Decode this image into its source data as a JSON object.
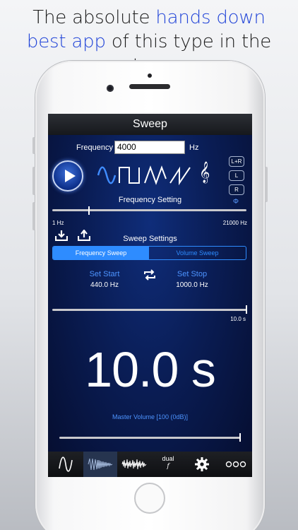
{
  "headline": {
    "part1": "The absolute ",
    "highlight1": "hands down",
    "highlight2": "best app",
    "part2": " of this type in the store."
  },
  "colors": {
    "headline_highlight": "#2245d8",
    "accent_blue": "#2e8cff",
    "screen_bg": "#0a1d55"
  },
  "screen": {
    "title": "Sweep",
    "frequency_label": "Frequency",
    "frequency_value": "4000",
    "frequency_unit": "Hz",
    "play_icon": "play-icon",
    "waveforms": [
      "sine-wave-icon",
      "square-wave-icon",
      "triangle-wave-icon",
      "sawtooth-wave-icon"
    ],
    "treble_clef_icon": "treble-clef-icon",
    "channels": [
      "L+R",
      "L",
      "R"
    ],
    "phase_symbol": "Φ",
    "frequency_setting_label": "Frequency Setting",
    "freq_slider_min": "1 Hz",
    "freq_slider_max": "21000 Hz",
    "freq_slider_fraction": 0.19,
    "download_icon": "download-icon",
    "upload_icon": "upload-icon",
    "sweep_settings_label": "Sweep Settings",
    "segments": [
      "Frequency Sweep",
      "Volume Sweep"
    ],
    "segment_selected": "Frequency Sweep",
    "set_start_label": "Set Start",
    "set_start_value": "440.0 Hz",
    "swap_icon": "swap-icon",
    "set_stop_label": "Set Stop",
    "set_stop_value": "1000.0 Hz",
    "duration_slider_value": "10.0 s",
    "duration_slider_fraction": 1.0,
    "big_time": "10.0 s",
    "master_volume_label": "Master Volume [100 (0dB)]",
    "volume_slider_fraction": 1.0,
    "tabs": [
      {
        "name": "tone-tab",
        "icon": "sine-wave-icon"
      },
      {
        "name": "sweep-tab",
        "icon": "sweep-icon",
        "active": true
      },
      {
        "name": "noise-tab",
        "icon": "noise-icon"
      },
      {
        "name": "dual-tab",
        "label_top": "dual",
        "label_bottom": "f"
      },
      {
        "name": "settings-tab",
        "icon": "gear-icon"
      },
      {
        "name": "more-tab",
        "icon": "more-icon"
      }
    ],
    "dual_label_top": "dual",
    "dual_label_bottom": "f"
  }
}
